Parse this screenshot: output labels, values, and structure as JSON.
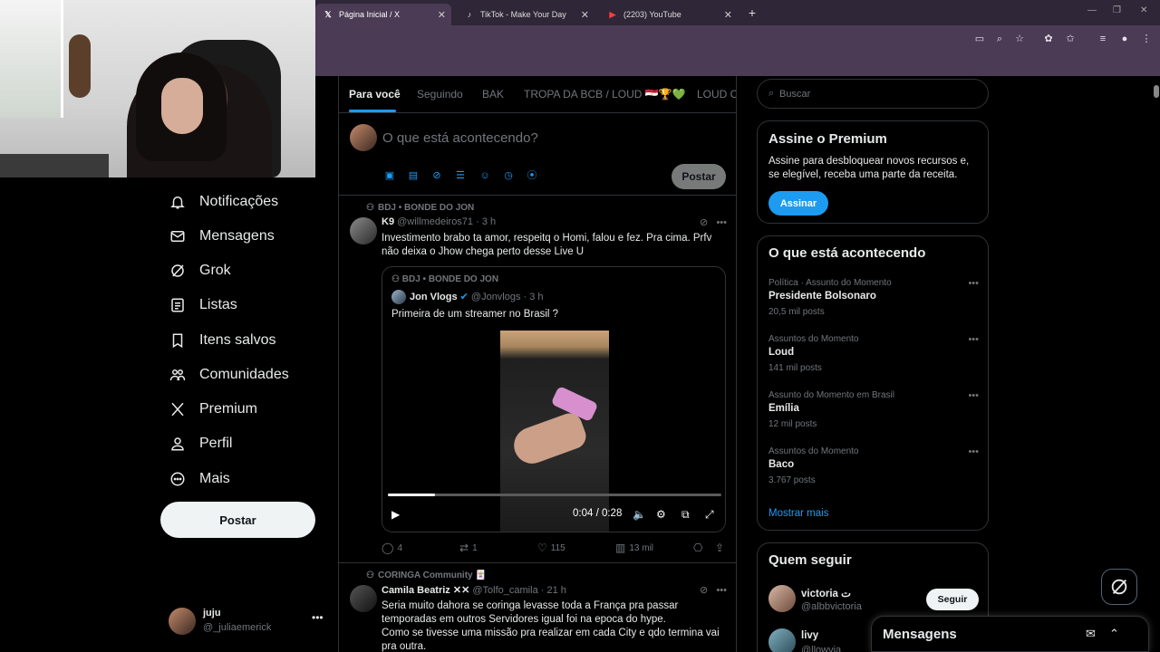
{
  "browser": {
    "tabs": [
      {
        "label": "Página Inicial / X",
        "icon": "x-logo-icon"
      },
      {
        "label": "TikTok - Make Your Day",
        "icon": "tiktok-icon"
      },
      {
        "label": "(2203) YouTube",
        "icon": "youtube-icon"
      }
    ],
    "accent": "#4b3b54"
  },
  "nav": {
    "items": [
      {
        "label": "Notificações",
        "icon": "bell-icon"
      },
      {
        "label": "Mensagens",
        "icon": "envelope-icon"
      },
      {
        "label": "Grok",
        "icon": "grok-icon"
      },
      {
        "label": "Listas",
        "icon": "list-icon"
      },
      {
        "label": "Itens salvos",
        "icon": "bookmark-icon"
      },
      {
        "label": "Comunidades",
        "icon": "people-icon"
      },
      {
        "label": "Premium",
        "icon": "x-logo-icon"
      },
      {
        "label": "Perfil",
        "icon": "person-icon"
      },
      {
        "label": "Mais",
        "icon": "more-circle-icon"
      }
    ],
    "post_label": "Postar",
    "account": {
      "name": "juju",
      "handle": "@_juliaemerick"
    }
  },
  "feed": {
    "tabs": [
      "Para você",
      "Seguindo",
      "BAK",
      "TROPA DA BCB / LOUD 🇪🇬🏆💚",
      "LOUD Co"
    ],
    "compose": {
      "placeholder": "O que está acontecendo?",
      "post_label": "Postar"
    },
    "tweets": [
      {
        "context": "BDJ • BONDE DO JON",
        "name": "K9",
        "handle": "@willmedeiros71 · 3 h",
        "text": "Investimento brabo ta amor, respeitq o Homi, falou e fez. Pra cima. Prfv não deixa o Jhow chega perto desse Live U",
        "quote": {
          "context": "BDJ • BONDE DO JON",
          "name": "Jon Vlogs",
          "handle": "@Jonvlogs · 3 h",
          "text": "Primeira de um streamer no Brasil ?",
          "video_time": "0:04 / 0:28",
          "video_progress": 0.14
        },
        "stats": {
          "replies": "4",
          "retweets": "1",
          "likes": "115",
          "views": "13 mil"
        }
      },
      {
        "context": "CORINGA Community 🃏",
        "name": "Camila Beatriz ✕✕",
        "handle": "@Tolfo_camila · 21 h",
        "text": "Seria muito dahora se coringa levasse toda a França pra passar temporadas em outros Servidores igual foi na epoca do hype.\nComo se tivesse uma missão pra realizar em cada City e qdo termina vai pra outra."
      }
    ]
  },
  "right": {
    "search_placeholder": "Buscar",
    "premium": {
      "title": "Assine o Premium",
      "desc": "Assine para desbloquear novos recursos e, se elegível, receba uma parte da receita.",
      "button": "Assinar"
    },
    "trends": {
      "title": "O que está acontecendo",
      "items": [
        {
          "category": "Política · Assunto do Momento",
          "title": "Presidente Bolsonaro",
          "count": "20,5 mil posts"
        },
        {
          "category": "Assuntos do Momento",
          "title": "Loud",
          "count": "141 mil posts"
        },
        {
          "category": "Assunto do Momento em Brasil",
          "title": "Emília",
          "count": "12 mil posts"
        },
        {
          "category": "Assuntos do Momento",
          "title": "Baco",
          "count": "3.767 posts"
        }
      ],
      "show_more": "Mostrar mais"
    },
    "follow": {
      "title": "Quem seguir",
      "items": [
        {
          "name": "victoria ت",
          "handle": "@albbvictoria",
          "button": "Seguir"
        },
        {
          "name": "livy",
          "handle": "@llowvia"
        }
      ]
    }
  },
  "messages": {
    "title": "Mensagens"
  },
  "colors": {
    "accent_blue": "#1d9bf0",
    "background": "#000000",
    "muted": "#71767b"
  }
}
